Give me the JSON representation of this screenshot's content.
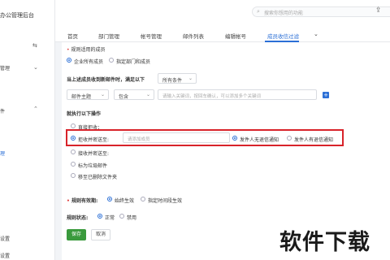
{
  "sidebar": {
    "brand": "办公管理后台",
    "items": [
      {
        "label": "管理"
      },
      {
        "label": "件"
      },
      {
        "label": "理"
      },
      {
        "label": "设置"
      },
      {
        "label": "设置"
      }
    ]
  },
  "search": {
    "placeholder": "搜索你想用的功能"
  },
  "tabs": [
    {
      "label": "首页"
    },
    {
      "label": "部门管理"
    },
    {
      "label": "帐号管理"
    },
    {
      "label": "邮件列表"
    },
    {
      "label": "编辑帐号"
    },
    {
      "label": "成员收信过滤"
    }
  ],
  "form": {
    "scope_title": "规则适用的成员",
    "scope_opt_all": "企业所有成员",
    "scope_opt_specific": "指定部门和成员",
    "condition_title": "当上述成员收到新邮件时，满足以下",
    "condition_select": "所有条件",
    "field_select": "邮件主题",
    "op_select": "包含",
    "keyword_placeholder": "请输入关键词，按回车确认，可以添加多个关键词",
    "action_title": "就执行以下操作",
    "actions": {
      "direct_reject": "直接拒收；",
      "reject_send_to": "拒收并密送至:",
      "member_placeholder": "请添加成员",
      "notify_sender": "发件人无退信通知",
      "notify_sender_bounce": "发件人有退信通知",
      "accept_send_to": "接收并密送至:",
      "mark_spam": "标为垃圾邮件",
      "move_deleted": "移至已删除文件夹"
    },
    "validity_label": "规则有效期:",
    "validity_always": "始终生效",
    "validity_period": "指定时间段生效",
    "status_label": "规则状态:",
    "status_on": "正常",
    "status_off": "禁用",
    "save": "保存",
    "cancel": "取消"
  },
  "watermark": "软件下载",
  "colors": {
    "accent": "#2b6fd6",
    "highlight": "#d8232a",
    "save": "#3a9a3d"
  }
}
